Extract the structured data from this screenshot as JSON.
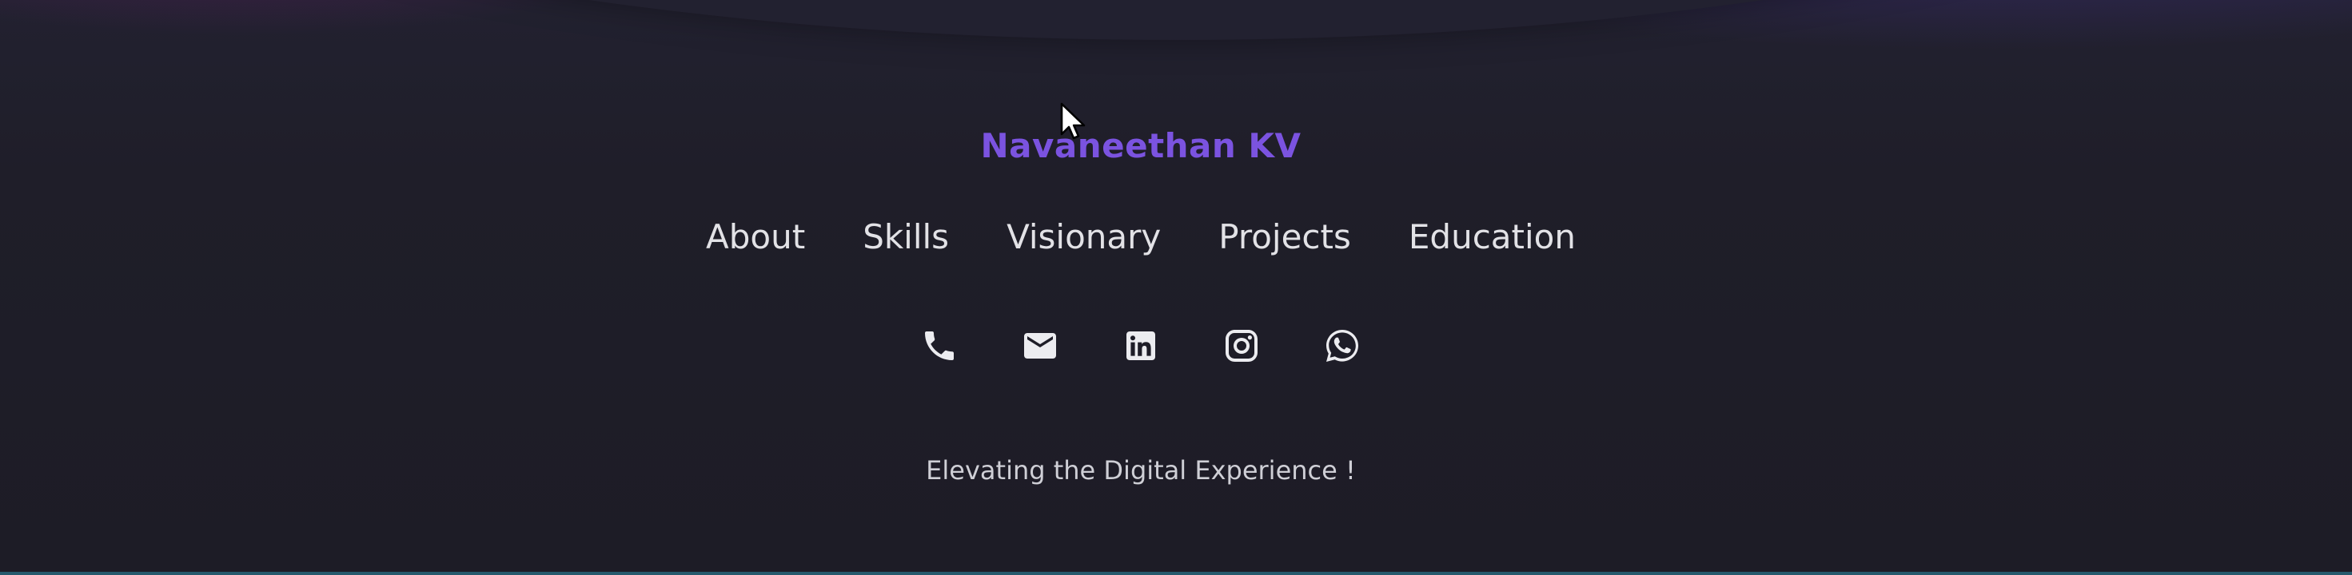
{
  "footer": {
    "brand_name": "Navaneethan KV",
    "nav": [
      {
        "label": "About"
      },
      {
        "label": "Skills"
      },
      {
        "label": "Visionary"
      },
      {
        "label": "Projects"
      },
      {
        "label": "Education"
      }
    ],
    "socials": [
      {
        "icon": "phone-icon"
      },
      {
        "icon": "email-icon"
      },
      {
        "icon": "linkedin-icon"
      },
      {
        "icon": "instagram-icon"
      },
      {
        "icon": "whatsapp-icon"
      }
    ],
    "tagline": "Elevating the Digital Experience !"
  },
  "colors": {
    "background": "#1e1d27",
    "brand": "#7b53e0",
    "text": "#e2e2e6",
    "tagline": "#cfcfd6",
    "bottom_accent": "#2a6f86"
  }
}
